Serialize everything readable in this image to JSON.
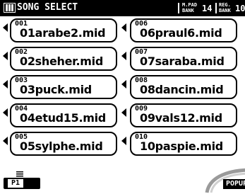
{
  "header": {
    "title": "SONG SELECT",
    "mpad_label": [
      "M.PAD",
      "BANK"
    ],
    "mpad_value": "14",
    "reg_label": [
      "REG.",
      "BANK"
    ],
    "reg_value": "10"
  },
  "songs": [
    {
      "number": "001",
      "name": "01arabe2.mid"
    },
    {
      "number": "002",
      "name": "02sheher.mid"
    },
    {
      "number": "003",
      "name": "03puck.mid"
    },
    {
      "number": "004",
      "name": "04etud15.mid"
    },
    {
      "number": "005",
      "name": "05sylphe.mid"
    },
    {
      "number": "006",
      "name": "06praul6.mid"
    },
    {
      "number": "007",
      "name": "07saraba.mid"
    },
    {
      "number": "008",
      "name": "08dancin.mid"
    },
    {
      "number": "009",
      "name": "09vals12.mid"
    },
    {
      "number": "010",
      "name": "10paspie.mid"
    }
  ],
  "footer": {
    "page_tab": "P1",
    "popup": "POPUP"
  },
  "icons": {
    "header": "disk-icon",
    "row_selector": "left-arrow-icon",
    "page_tab": "page-lines-icon"
  }
}
